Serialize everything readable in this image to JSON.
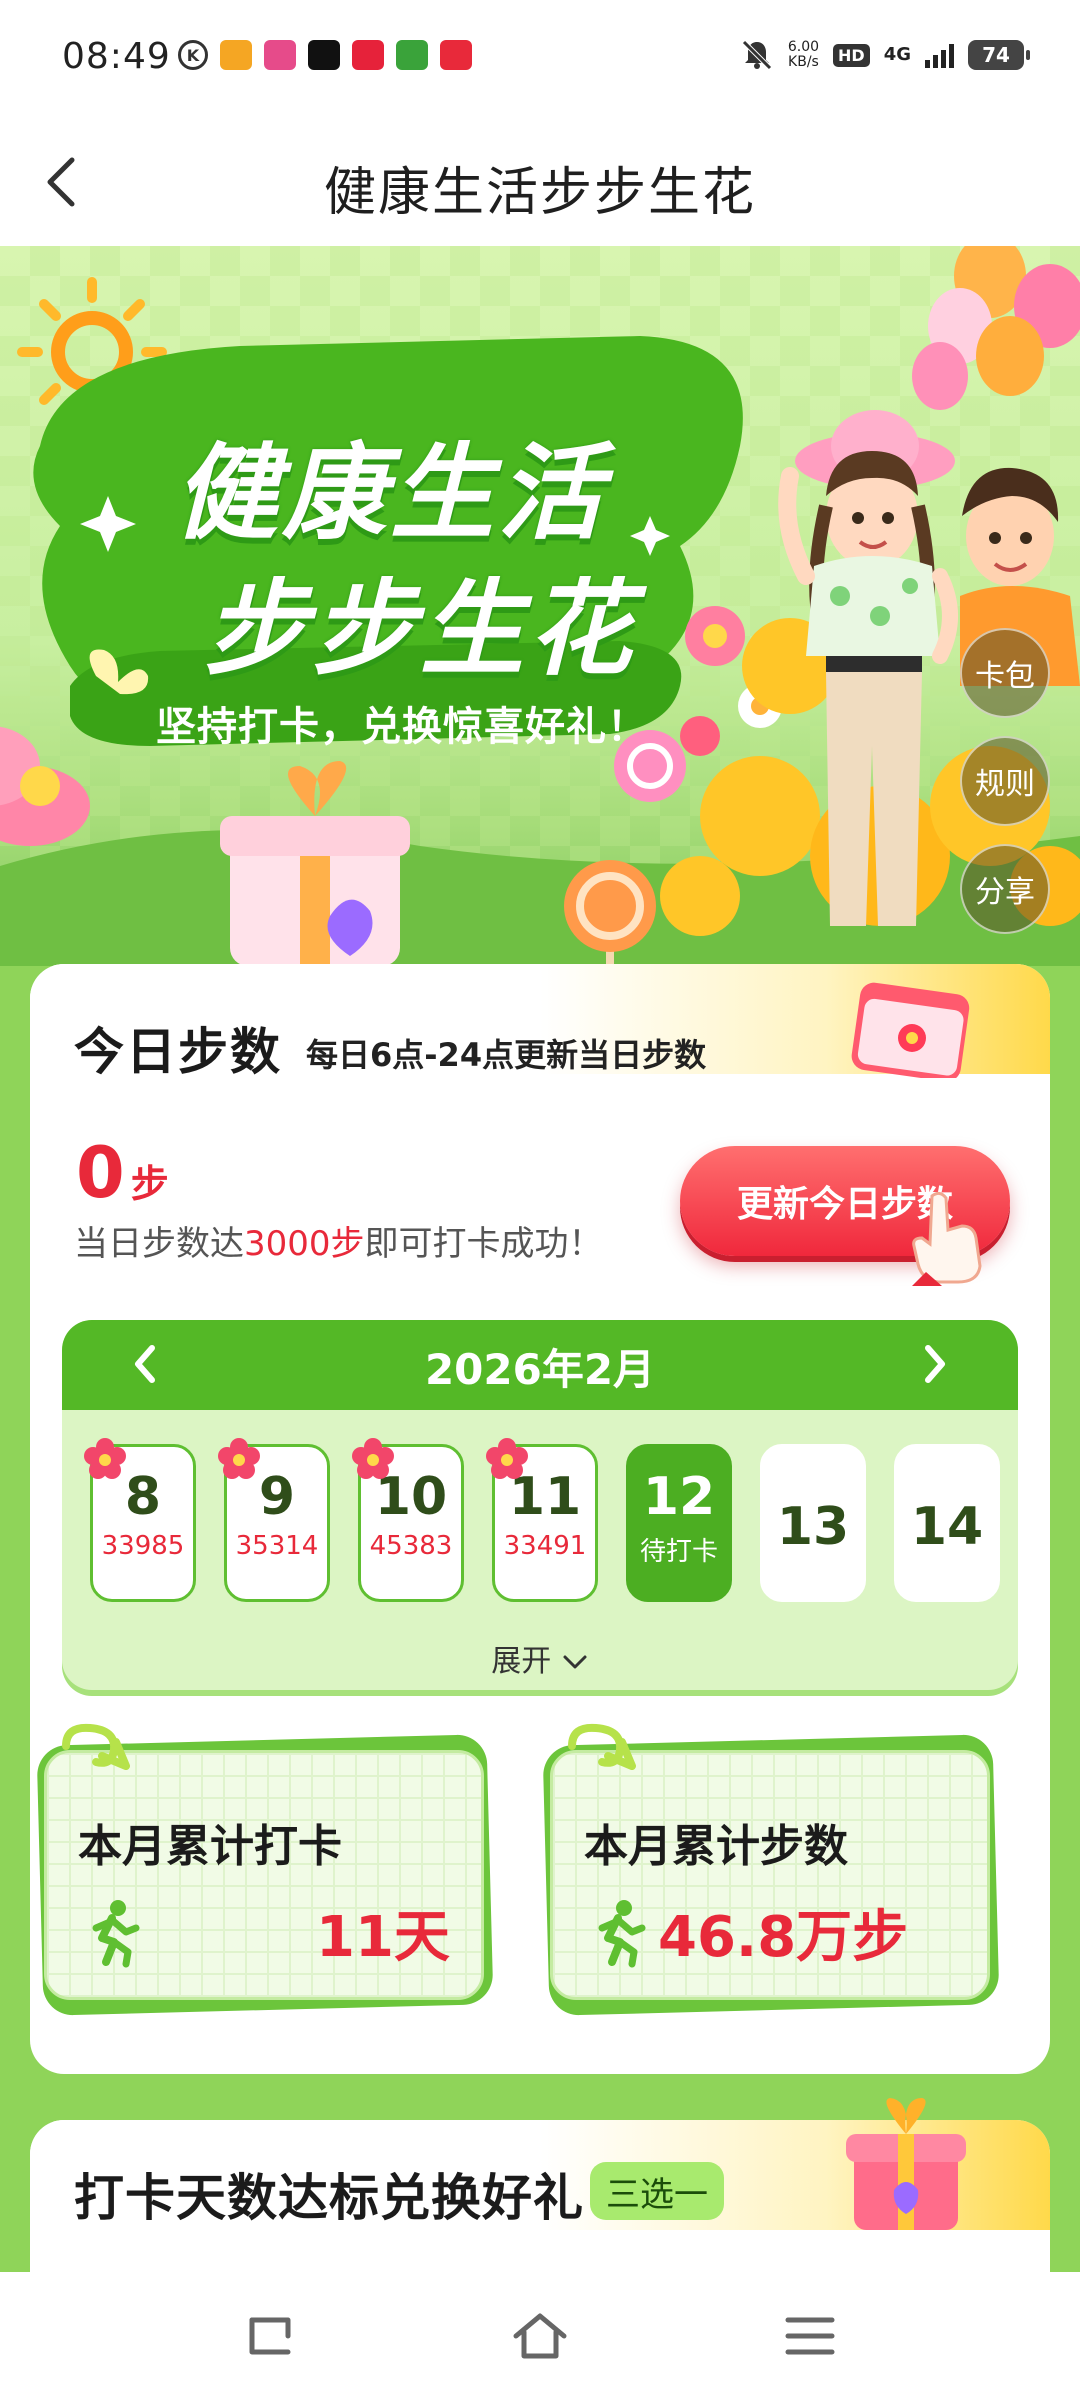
{
  "status_bar": {
    "time": "08:49",
    "net_speed_value": "6.00",
    "net_speed_unit": "KB/s",
    "hd": "HD",
    "network": "4G",
    "battery": "74"
  },
  "header": {
    "title": "健康生活步步生花"
  },
  "banner": {
    "headline_line1": "健康生活",
    "headline_line2": "步步生花",
    "slogan": "坚持打卡，兑换惊喜好礼！",
    "side_buttons": [
      "卡包",
      "规则",
      "分享"
    ]
  },
  "today": {
    "title": "今日步数",
    "subtitle": "每日6点-24点更新当日步数",
    "steps_value": "0",
    "steps_unit": "步",
    "tip_prefix": "当日步数达",
    "tip_highlight": "3000步",
    "tip_suffix": "即可打卡成功！",
    "update_button": "更新今日步数"
  },
  "calendar": {
    "month_label": "2026年2月",
    "days": [
      {
        "date": "8",
        "sub": "33985",
        "state": "done"
      },
      {
        "date": "9",
        "sub": "35314",
        "state": "done"
      },
      {
        "date": "10",
        "sub": "45383",
        "state": "done"
      },
      {
        "date": "11",
        "sub": "33491",
        "state": "done"
      },
      {
        "date": "12",
        "sub": "待打卡",
        "state": "today"
      },
      {
        "date": "13",
        "sub": "",
        "state": "future"
      },
      {
        "date": "14",
        "sub": "",
        "state": "future"
      }
    ],
    "expand_label": "展开"
  },
  "stats": {
    "checkin_title": "本月累计打卡",
    "checkin_value": "11天",
    "steps_title": "本月累计步数",
    "steps_value": "46.8万步"
  },
  "gift_section": {
    "title": "打卡天数达标兑换好礼",
    "badge": "三选一"
  },
  "colors": {
    "accent_green": "#54b826",
    "highlight_red": "#e8293a",
    "page_bg_green": "#8fd459"
  }
}
